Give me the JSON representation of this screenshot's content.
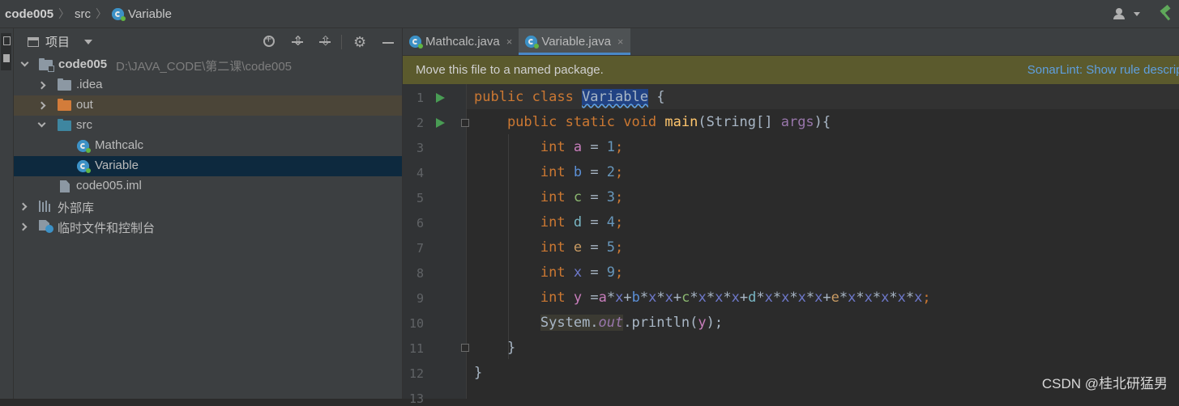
{
  "breadcrumb": {
    "project": "code005",
    "folder": "src",
    "file": "Variable"
  },
  "project_panel": {
    "title": "项目",
    "tree": {
      "root_name": "code005",
      "root_path": "D:\\JAVA_CODE\\第二课\\code005",
      "idea": ".idea",
      "out": "out",
      "src": "src",
      "file1": "Mathcalc",
      "file2": "Variable",
      "iml": "code005.iml",
      "external_libs": "外部库",
      "scratches": "临时文件和控制台"
    }
  },
  "tabs": [
    {
      "label": "Mathcalc.java",
      "close": "×"
    },
    {
      "label": "Variable.java",
      "close": "×"
    }
  ],
  "notice": {
    "message": "Move this file to a named package.",
    "link": "SonarLint: Show rule descripti"
  },
  "line_numbers": [
    "1",
    "2",
    "3",
    "4",
    "5",
    "6",
    "7",
    "8",
    "9",
    "10",
    "11",
    "12",
    "13"
  ],
  "code": {
    "l1_kw": "public class ",
    "l1_name": "Variable",
    "l1_rest": " {",
    "l2_kw": "    public static void ",
    "l2_method": "main",
    "l2_sig_a": "(String[] ",
    "l2_param": "args",
    "l2_sig_b": "){",
    "decls": [
      {
        "kw": "        int ",
        "name": "a",
        "eq": " = ",
        "val": "1",
        "end": ";"
      },
      {
        "kw": "        int ",
        "name": "b",
        "eq": " = ",
        "val": "2",
        "end": ";"
      },
      {
        "kw": "        int ",
        "name": "c",
        "eq": " = ",
        "val": "3",
        "end": ";"
      },
      {
        "kw": "        int ",
        "name": "d",
        "eq": " = ",
        "val": "4",
        "end": ";"
      },
      {
        "kw": "        int ",
        "name": "e",
        "eq": " = ",
        "val": "5",
        "end": ";"
      },
      {
        "kw": "        int ",
        "name": "x",
        "eq": " = ",
        "val": "9",
        "end": ";"
      }
    ],
    "l9_kw": "        int ",
    "l9_name": "y",
    "l9_expr": " =a*x+b*x*x+c*x*x*x+d*x*x*x*x+e*x*x*x*x*x;",
    "l10_indent": "        ",
    "l10_sys": "System.",
    "l10_out": "out",
    "l10_call": ".println(",
    "l10_arg": "y",
    "l10_end": ");",
    "l11": "    }",
    "l12": "}"
  },
  "watermark": "CSDN @桂北研猛男"
}
